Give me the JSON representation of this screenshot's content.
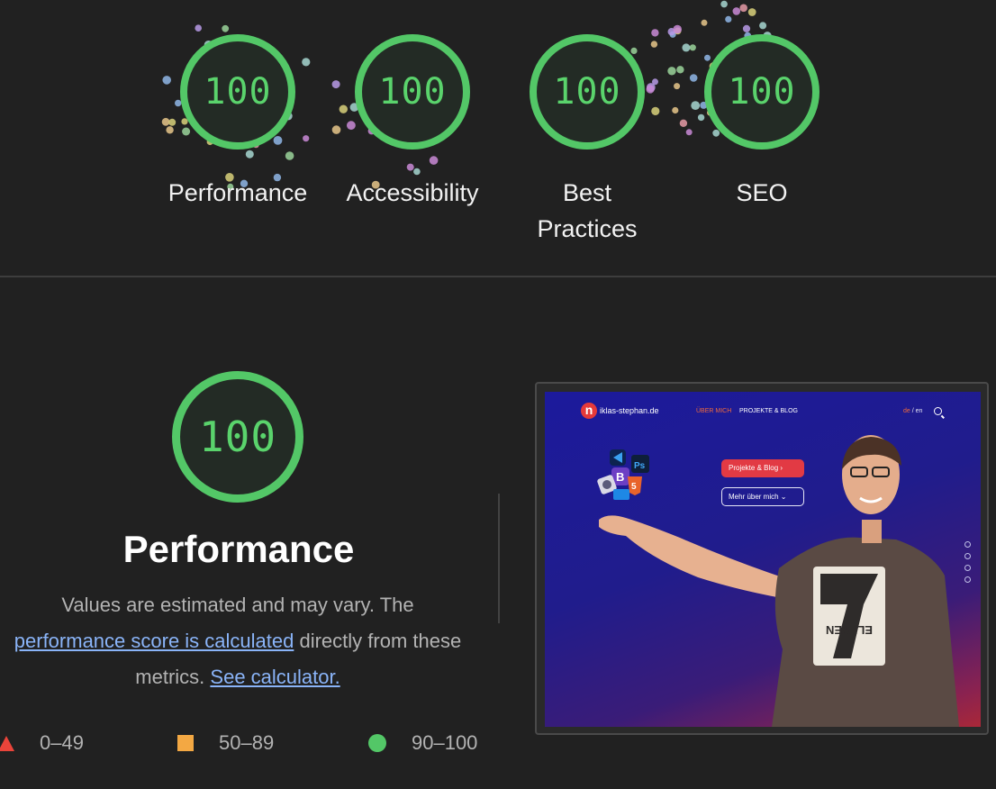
{
  "categories": [
    {
      "label": "Performance",
      "score": "100"
    },
    {
      "label": "Accessibility",
      "score": "100"
    },
    {
      "label": "Best Practices",
      "score": "100"
    },
    {
      "label": "SEO",
      "score": "100"
    }
  ],
  "performance": {
    "score": "100",
    "title": "Performance",
    "desc_prefix": "Values are estimated and may vary. The",
    "link_score": "performance score is calculated",
    "desc_mid": "directly from these metrics.",
    "link_calculator": "See calculator."
  },
  "legend": [
    {
      "range": "0–49",
      "shape": "triangle",
      "color": "#e9443a"
    },
    {
      "range": "50–89",
      "shape": "square",
      "color": "#f3a843"
    },
    {
      "range": "90–100",
      "shape": "circle",
      "color": "#53c767"
    }
  ],
  "screenshot": {
    "logo_letter": "n",
    "site_name": "iklas-stephan.de",
    "nav_about": "ÜBER MICH",
    "nav_projects": "PROJEKTE & BLOG",
    "lang_de": "de",
    "lang_sep": "/",
    "lang_en": "en",
    "btn_projects": "Projekte & Blog ›",
    "btn_more": "Mehr über mich ⌄",
    "shirt_text": "ELEVEN"
  },
  "colors": {
    "pass": "#53c767",
    "average": "#f3a843",
    "fail": "#e9443a",
    "link": "#8ab4f8"
  }
}
